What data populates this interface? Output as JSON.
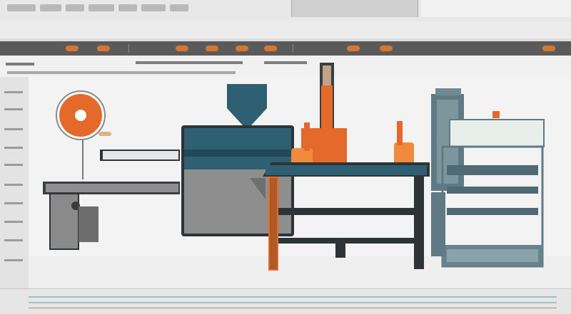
{
  "palette": {
    "accent_orange": "#e4692a",
    "steel_blue": "#2f5f73",
    "machine_grey": "#6b7a82",
    "dark_frame": "#2e3336"
  },
  "illustration": {
    "items": [
      {
        "name": "reel",
        "icon": "spool-icon"
      },
      {
        "name": "conveyor",
        "icon": "conveyor-icon"
      },
      {
        "name": "hopper-press",
        "icon": "press-icon"
      },
      {
        "name": "workbench",
        "icon": "table-icon"
      },
      {
        "name": "cabinet-machine",
        "icon": "cabinet-icon"
      }
    ]
  }
}
